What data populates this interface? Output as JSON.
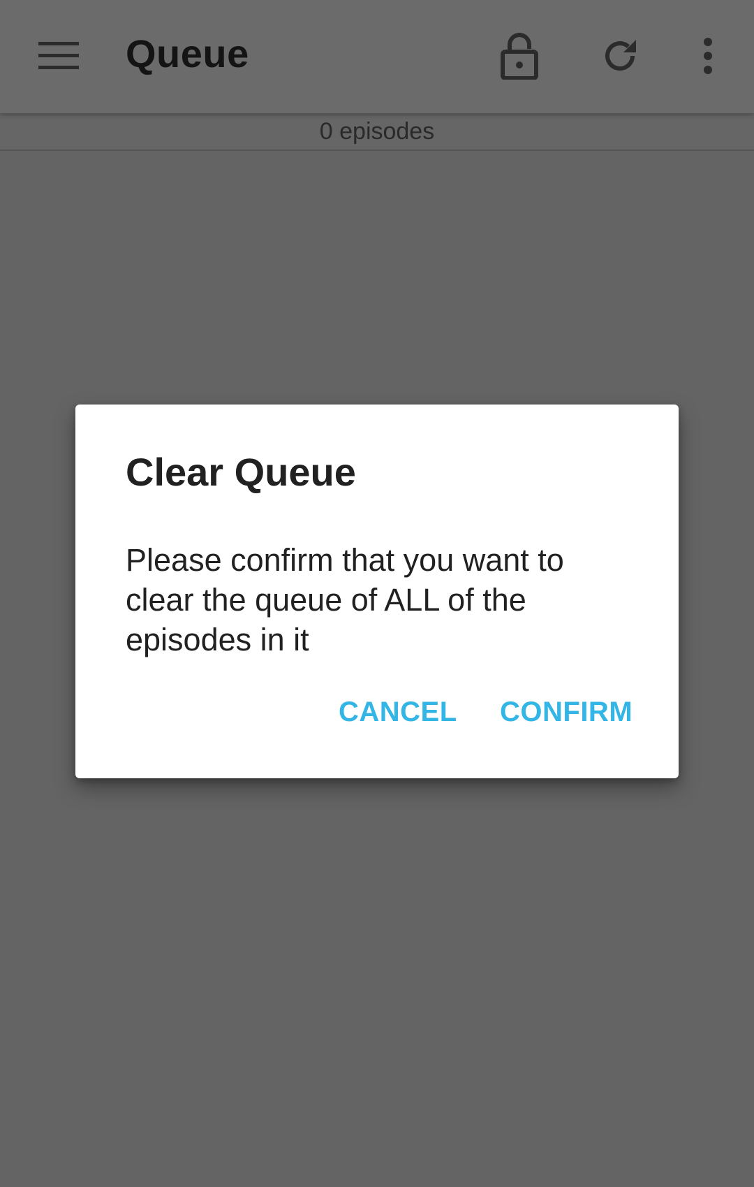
{
  "toolbar": {
    "title": "Queue",
    "icons": {
      "menu": "menu-icon",
      "lock": "lock-open-icon",
      "refresh": "refresh-icon",
      "more": "more-vert-icon"
    }
  },
  "subheader": {
    "episode_count": "0 episodes"
  },
  "dialog": {
    "title": "Clear Queue",
    "message": "Please confirm that you want to clear the queue of ALL of the episodes in it",
    "cancel_label": "CANCEL",
    "confirm_label": "CONFIRM"
  },
  "colors": {
    "accent": "#33b5e5",
    "scrim": "#646464",
    "dialog_bg": "#ffffff"
  }
}
